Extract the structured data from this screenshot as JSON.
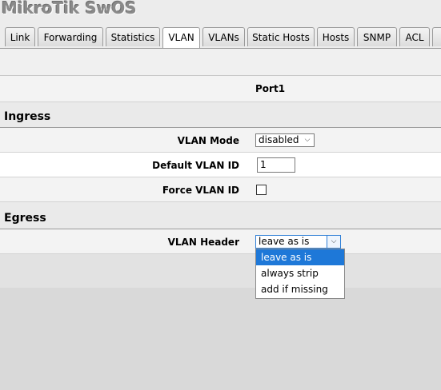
{
  "app": {
    "title": "MikroTik SwOS"
  },
  "tabs": [
    {
      "label": "Link",
      "active": false
    },
    {
      "label": "Forwarding",
      "active": false
    },
    {
      "label": "Statistics",
      "active": false
    },
    {
      "label": "VLAN",
      "active": true
    },
    {
      "label": "VLANs",
      "active": false
    },
    {
      "label": "Static Hosts",
      "active": false
    },
    {
      "label": "Hosts",
      "active": false
    },
    {
      "label": "SNMP",
      "active": false
    },
    {
      "label": "ACL",
      "active": false
    }
  ],
  "table": {
    "port_header": "Port1",
    "ingress": {
      "section_title": "Ingress",
      "vlan_mode_label": "VLAN Mode",
      "vlan_mode_value": "disabled",
      "default_vlan_id_label": "Default VLAN ID",
      "default_vlan_id_value": "1",
      "force_vlan_id_label": "Force VLAN ID",
      "force_vlan_id_checked": false
    },
    "egress": {
      "section_title": "Egress",
      "vlan_header_label": "VLAN Header",
      "vlan_header_value": "leave as is",
      "vlan_header_options": [
        "leave as is",
        "always strip",
        "add if missing"
      ],
      "vlan_header_highlighted": "leave as is"
    }
  },
  "colors": {
    "highlight": "#1e78d8",
    "title_gray": "#8a8a8a"
  }
}
